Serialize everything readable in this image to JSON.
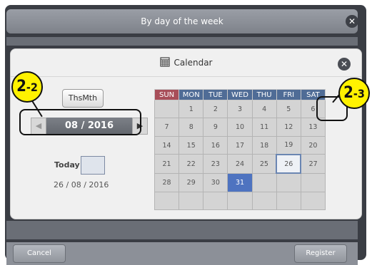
{
  "top_bar": {
    "title": "By day of the week",
    "close_glyph": "✕"
  },
  "footer": {
    "cancel_label": "Cancel",
    "register_label": "Register"
  },
  "dialog": {
    "title": "Calendar",
    "close_glyph": "✕",
    "this_month_label": "ThsMth",
    "month_nav": {
      "prev_glyph": "◀",
      "month_value": "08 / 2016",
      "next_glyph": "▶"
    },
    "today": {
      "label": "Today",
      "date_value": "26 / 08 / 2016"
    }
  },
  "calendar": {
    "weekdays": [
      "SUN",
      "MON",
      "TUE",
      "WED",
      "THU",
      "FRI",
      "SAT"
    ],
    "weeks": [
      [
        "",
        "1",
        "2",
        "3",
        "4",
        "5",
        "6"
      ],
      [
        "7",
        "8",
        "9",
        "10",
        "11",
        "12",
        "13"
      ],
      [
        "14",
        "15",
        "16",
        "17",
        "18",
        "19",
        "20"
      ],
      [
        "21",
        "22",
        "23",
        "24",
        "25",
        "26",
        "27"
      ],
      [
        "28",
        "29",
        "30",
        "31",
        "",
        "",
        ""
      ],
      [
        "",
        "",
        "",
        "",
        "",
        "",
        ""
      ]
    ],
    "selected_day": "31",
    "today_day": "26"
  },
  "annotations": {
    "callout_left": {
      "main": "2",
      "sub": "-2"
    },
    "callout_right": {
      "main": "2",
      "sub": "-3"
    }
  },
  "colors": {
    "sunday_header": "#a84e59",
    "weekday_header": "#4f6c96",
    "selected": "#4e73c0",
    "badge": "#fff200"
  }
}
